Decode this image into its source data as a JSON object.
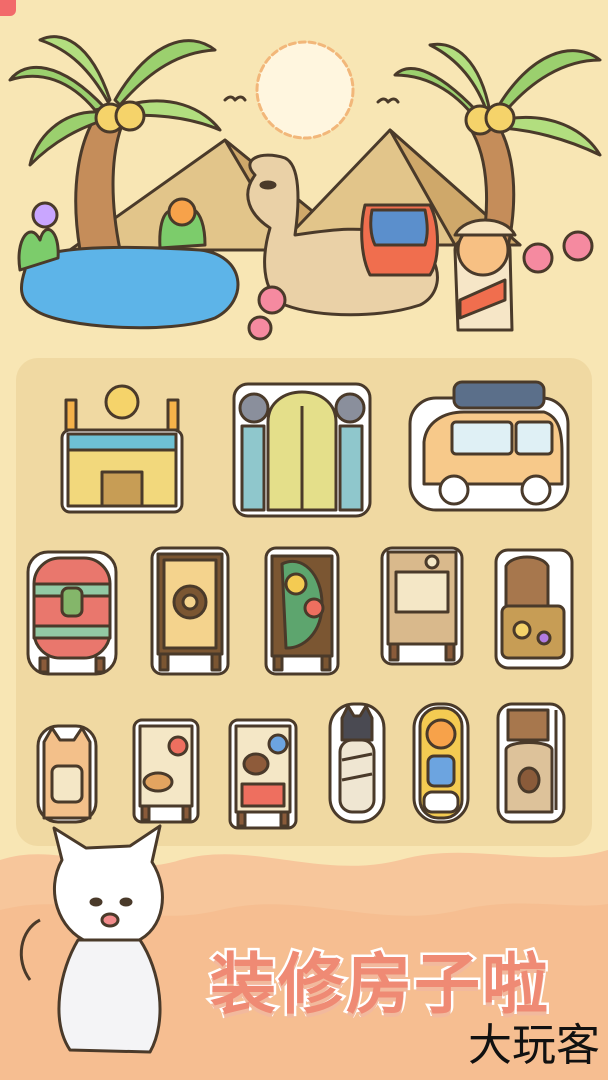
{
  "promo": {
    "headline": "装修房子啦",
    "watermark": "大玩客"
  },
  "colors": {
    "background": "#f8e6b4",
    "panel": "#f0d9a2",
    "headline": "#ef8a74",
    "sun": "#fff6df",
    "water": "#5db4e8"
  },
  "scene": {
    "elements": [
      "sun-icon",
      "palm-tree-icon",
      "pyramid-icon",
      "oasis-pond-icon",
      "camel-icon",
      "explorer-cat-icon",
      "flower-icon",
      "bird-icon"
    ]
  },
  "furniture_items": [
    "egyptian-temple-gate-icon",
    "gargoyle-archway-icon",
    "cat-bus-icon",
    "patterned-wardrobe-icon",
    "sun-cabinet-icon",
    "fruit-cabinet-icon",
    "map-board-icon",
    "treasure-chest-icon",
    "cat-statue-icon",
    "bread-shelf-icon",
    "meat-shelf-icon",
    "mummy-cat-icon",
    "sarcophagus-cat-icon",
    "supply-sack-icon"
  ]
}
